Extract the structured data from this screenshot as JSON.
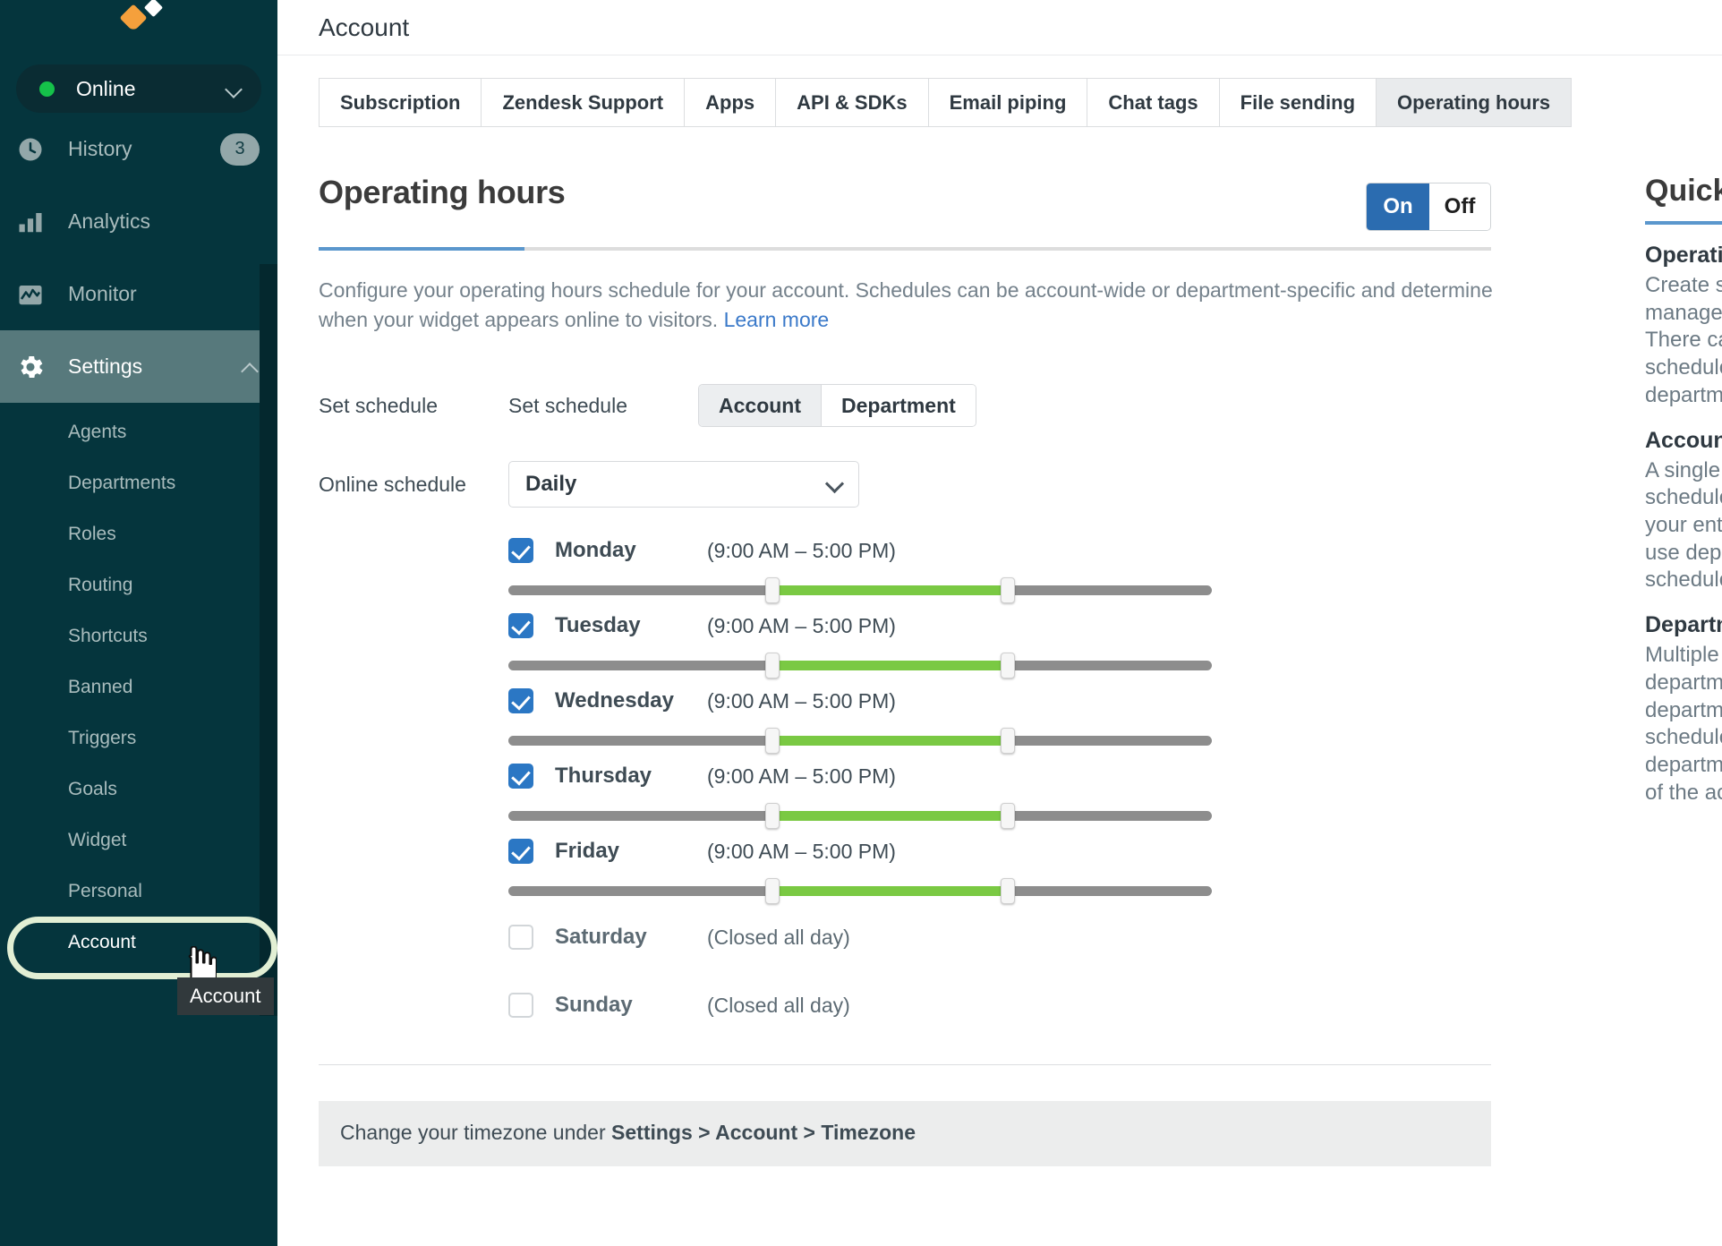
{
  "sidebar": {
    "logo_name": "livechat-logo",
    "status": {
      "label": "Online",
      "state_color": "#15c24a"
    },
    "nav": [
      {
        "label": "History",
        "icon": "clock-icon",
        "badge": "3"
      },
      {
        "label": "Analytics",
        "icon": "bar-chart-icon",
        "badge": ""
      },
      {
        "label": "Monitor",
        "icon": "monitor-chart-icon",
        "badge": ""
      },
      {
        "label": "Settings",
        "icon": "gear-icon",
        "badge": ""
      }
    ],
    "settings_subitems": [
      {
        "label": "Agents"
      },
      {
        "label": "Departments"
      },
      {
        "label": "Roles"
      },
      {
        "label": "Routing"
      },
      {
        "label": "Shortcuts"
      },
      {
        "label": "Banned"
      },
      {
        "label": "Triggers"
      },
      {
        "label": "Goals"
      },
      {
        "label": "Widget"
      },
      {
        "label": "Personal"
      },
      {
        "label": "Account"
      }
    ],
    "tooltip": "Account"
  },
  "header": {
    "title": "Account"
  },
  "tabs": [
    {
      "label": "Subscription",
      "selected": false
    },
    {
      "label": "Zendesk Support",
      "selected": false
    },
    {
      "label": "Apps",
      "selected": false
    },
    {
      "label": "API & SDKs",
      "selected": false
    },
    {
      "label": "Email piping",
      "selected": false
    },
    {
      "label": "Chat tags",
      "selected": false
    },
    {
      "label": "File sending",
      "selected": false
    },
    {
      "label": "Operating hours",
      "selected": true
    }
  ],
  "section": {
    "title": "Operating hours",
    "toggle": {
      "on_label": "On",
      "off_label": "Off",
      "selected": "On"
    },
    "description": "Configure your operating hours schedule for your account. Schedules can be account-wide or department-specific and determine when your widget appears online to visitors. ",
    "learn_more": "Learn more",
    "set_schedule_label": "Set schedule",
    "set_schedule_label2": "Set schedule",
    "scope": {
      "account": "Account",
      "department": "Department",
      "selected": "Account"
    },
    "online_schedule_label": "Online schedule",
    "online_schedule_value": "Daily",
    "note_prefix": "Change your timezone under ",
    "note_path": "Settings > Account > Timezone"
  },
  "schedule": {
    "days": [
      {
        "name": "Monday",
        "enabled": true,
        "hours": "(9:00 AM – 5:00 PM)",
        "start_pct": 37.5,
        "end_pct": 71.0
      },
      {
        "name": "Tuesday",
        "enabled": true,
        "hours": "(9:00 AM – 5:00 PM)",
        "start_pct": 37.5,
        "end_pct": 71.0
      },
      {
        "name": "Wednesday",
        "enabled": true,
        "hours": "(9:00 AM – 5:00 PM)",
        "start_pct": 37.5,
        "end_pct": 71.0
      },
      {
        "name": "Thursday",
        "enabled": true,
        "hours": "(9:00 AM – 5:00 PM)",
        "start_pct": 37.5,
        "end_pct": 71.0
      },
      {
        "name": "Friday",
        "enabled": true,
        "hours": "(9:00 AM – 5:00 PM)",
        "start_pct": 37.5,
        "end_pct": 71.0
      },
      {
        "name": "Saturday",
        "enabled": false,
        "hours": "(Closed all day)",
        "start_pct": 0,
        "end_pct": 0
      },
      {
        "name": "Sunday",
        "enabled": false,
        "hours": "(Closed all day)",
        "start_pct": 0,
        "end_pct": 0
      }
    ]
  },
  "quick_answers": {
    "title": "Quick answers",
    "blocks": [
      {
        "heading": "Operating hours",
        "body": "Create schedules to\nmanage availability.\nThere can be one\nschedule per\ndepartment."
      },
      {
        "heading": "Account schedule",
        "body": "A single operating hours\nschedule applied across\nyour entire account. Do not\nuse department\nschedules."
      },
      {
        "heading": "Department schedule",
        "body": "Multiple schedules, one per\ndepartment. Each\ndepartment has its own\nschedule and the\ndepartment hours override\nof the account."
      }
    ]
  },
  "colors": {
    "sidebar_bg": "#05353d",
    "accent_blue": "#2b6cb0",
    "slider_green": "#7ac943",
    "highlight_ring": "#e2efd4"
  }
}
